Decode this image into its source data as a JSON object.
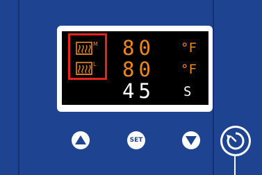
{
  "display": {
    "row1": {
      "value": "80",
      "unit": "°F"
    },
    "row2": {
      "value": "80",
      "unit": "°F"
    },
    "row3": {
      "value": "45",
      "unit": "S"
    },
    "mode_indicators": [
      {
        "name": "heater-m",
        "letter": "M"
      },
      {
        "name": "heater-l",
        "letter": "L"
      }
    ]
  },
  "buttons": {
    "up_icon": "triangle-up-icon",
    "set_label": "SET",
    "down_icon": "triangle-down-icon",
    "timer_icon": "timer-icon"
  },
  "colors": {
    "panel": "#1e4391",
    "lcd_background": "#000000",
    "digit_orange": "#f0891a",
    "digit_white": "#ffffff",
    "mode_highlight": "#e8221e"
  }
}
